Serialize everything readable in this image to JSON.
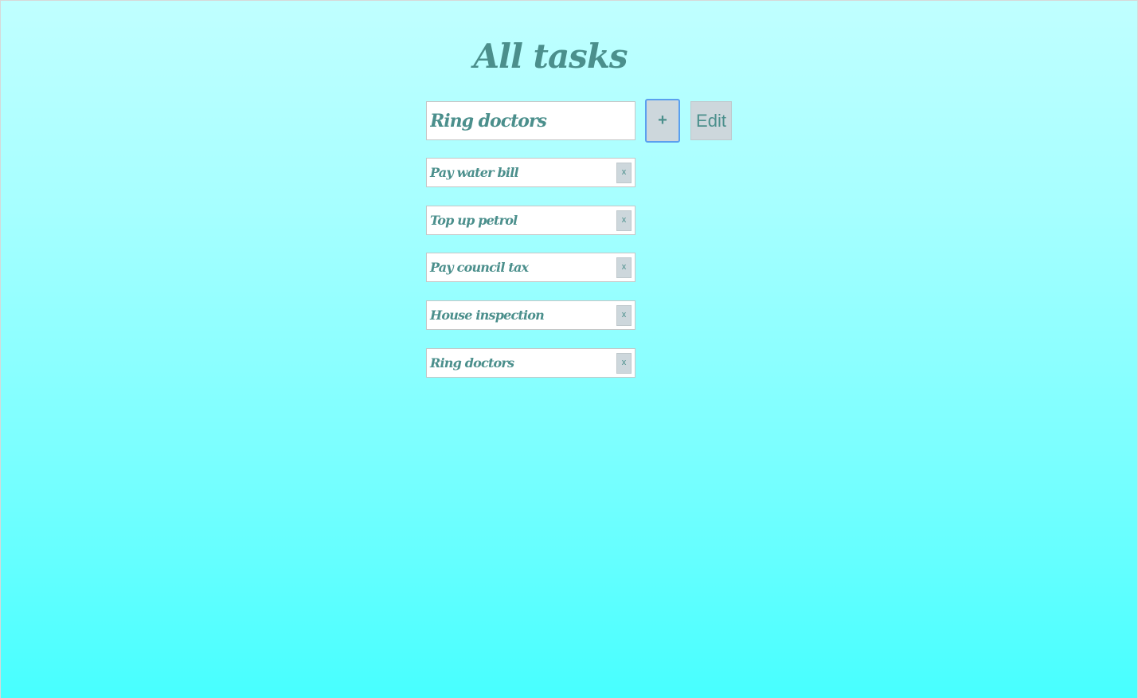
{
  "page": {
    "title": "All tasks"
  },
  "new_task": {
    "value": "Ring doctors",
    "add_label": "+",
    "edit_label": "Edit"
  },
  "tasks": [
    {
      "label": "Pay water bill",
      "remove_label": "x"
    },
    {
      "label": "Top up petrol",
      "remove_label": "x"
    },
    {
      "label": "Pay council tax",
      "remove_label": "x"
    },
    {
      "label": "House inspection",
      "remove_label": "x"
    },
    {
      "label": "Ring doctors",
      "remove_label": "x"
    }
  ],
  "colors": {
    "text": "#4b8f8c",
    "button_bg": "#cdd7dc",
    "focus_ring": "#5aa0ef",
    "gradient_top": "#c0ffff",
    "gradient_bottom": "#47ffff"
  }
}
